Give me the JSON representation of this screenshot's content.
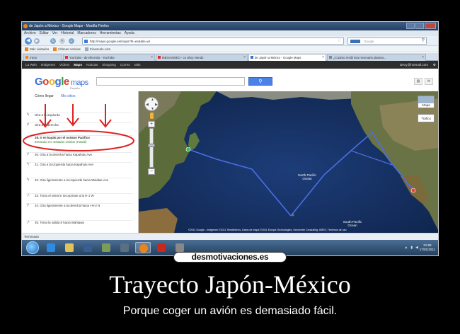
{
  "browser": {
    "window_title": "de Japón a México - Google Maps - Mozilla Firefox",
    "menu": [
      "Archivo",
      "Editar",
      "Ver",
      "Historial",
      "Marcadores",
      "Herramientas",
      "Ayuda"
    ],
    "url": "http://maps.google.es/maps?hl=es&tab=wl",
    "search_placeholder": "Google",
    "bookmarks": [
      "Más visitados",
      "Últimas noticias",
      "Cinescalo.com"
    ],
    "tabs": [
      "Inicio",
      "YouTube - de elhornito - YouTube",
      "MEGAVIDEO - co ahoy viendo",
      "de Japón a México - Google Maps",
      "¿Cuánto recibí Era necesario plasma..."
    ],
    "status": "Terminado"
  },
  "google_bar": {
    "links": [
      "La Web",
      "Imágenes",
      "Vídeos",
      "Maps",
      "Noticias",
      "Shopping",
      "Correo",
      "Más"
    ],
    "active": "Maps",
    "user": "alexy@hotmail.com"
  },
  "maps": {
    "logo_letters": [
      "G",
      "o",
      "o",
      "g",
      "l",
      "e"
    ],
    "logo_word": "maps",
    "country": "España",
    "panel_tabs": [
      "Cómo llegar",
      "Mis sitios"
    ],
    "steps": [
      {
        "text": "Gira a la izquierda",
        "dist": ""
      },
      {
        "text": "Gira a la derecha",
        "dist": ""
      },
      {
        "text": "29. Ir en kayak por el océano Pacífico",
        "sub": "Entrando en: Estados Unidos (Hawái)",
        "dist": ""
      },
      {
        "text": "30. Gira a la derecha hacia Kapahulu Ave",
        "dist": ""
      },
      {
        "text": "31. Gira a la izquierda hacia Kapahulu Ave",
        "dist": ""
      },
      {
        "text": "32. Gira ligeramente a la izquierda hacia Waialae Ave",
        "dist": ""
      },
      {
        "text": "33. Toma el ramal e incorpórate a la H-1 W",
        "dist": ""
      },
      {
        "text": "34. Gira ligeramente a la derecha hacia I-H-2 N",
        "dist": ""
      },
      {
        "text": "35. Toma la salida 8 hacia Wahiawa",
        "dist": ""
      }
    ],
    "map_types": [
      "Mapa",
      "Tráfico"
    ],
    "map_labels": {
      "north_pacific": "North Pacific Ocean",
      "south_pacific": "South Pacific Ocean"
    },
    "footer": "©2011 Google - Imágenes ©2011 TerraMetrics, Datos de mapa ©2011 Europa Technologies, Geocentre Consulting, INEGI, Términos de uso"
  },
  "taskbar": {
    "clock_time": "21:58",
    "clock_date": "17/01/2011"
  },
  "watermark": "desmotivaciones.es",
  "caption": {
    "title": "Trayecto Japón-México",
    "subtitle": "Porque coger un avión es demasiado fácil."
  },
  "colors": {
    "route": "#4a6fe0",
    "annotation": "#e02020",
    "ocean": "#1b3b74"
  }
}
